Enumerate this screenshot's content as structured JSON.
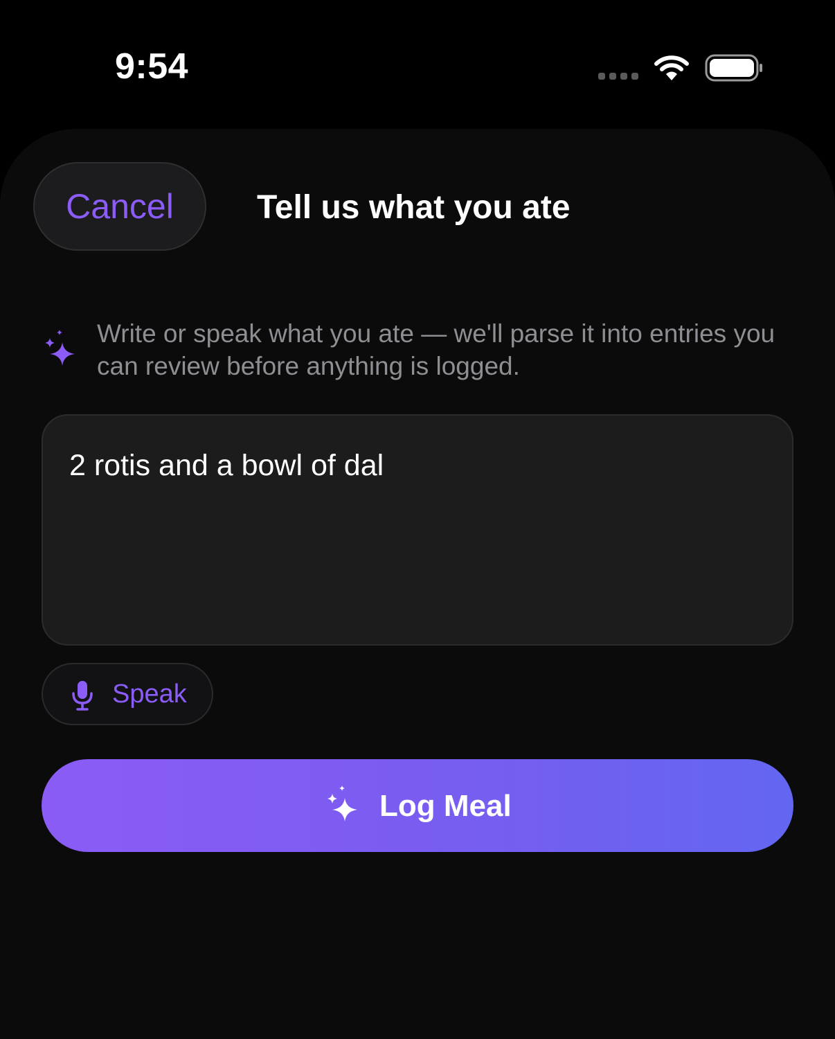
{
  "status_bar": {
    "time": "9:54"
  },
  "header": {
    "cancel_label": "Cancel",
    "title": "Tell us what you ate"
  },
  "hint": {
    "text": "Write or speak what you ate — we'll parse it into entries you can review before anything is logged.",
    "icon": "sparkles-icon"
  },
  "meal_input": {
    "value": "2 rotis and a bowl of dal",
    "placeholder": ""
  },
  "speak_button": {
    "label": "Speak",
    "icon": "microphone-icon"
  },
  "log_button": {
    "label": "Log Meal",
    "icon": "sparkles-icon"
  },
  "colors": {
    "accent": "#8b5cf6",
    "gradient_start": "#8b5cf6",
    "gradient_end": "#6366f1",
    "background": "#0b0b0c",
    "field": "#1c1c1d",
    "hint_text": "#8e8e93"
  }
}
